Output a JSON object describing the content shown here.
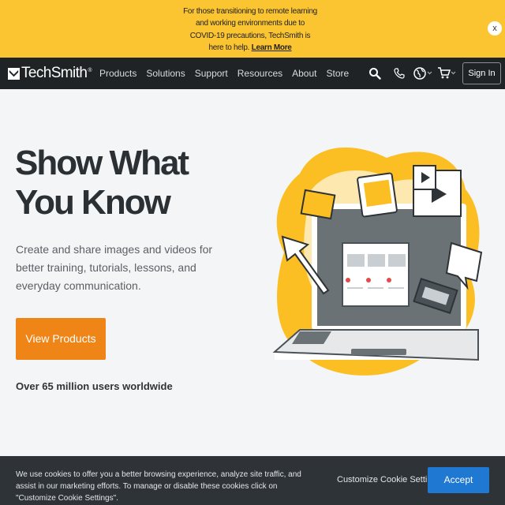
{
  "banner": {
    "text": "For those transitioning to remote learning and working environments due to COVID-19 precautions, TechSmith is here to help.",
    "link_label": "Learn More",
    "close_label": "x"
  },
  "nav": {
    "brand": "TechSmith",
    "registered": "®",
    "links": [
      "Products",
      "Solutions",
      "Support",
      "Resources",
      "About",
      "Store"
    ],
    "icons": [
      "search-icon",
      "phone-icon",
      "globe-icon",
      "cart-icon"
    ],
    "signin_label": "Sign In"
  },
  "hero": {
    "title_line1": "Show What",
    "title_line2": "You Know",
    "subtitle": "Create and share images and videos for better training, tutorials, lessons, and everyday communication.",
    "cta_label": "View Products",
    "users_text": "Over 65 million users worldwide"
  },
  "cookie": {
    "text": "We use cookies to offer you a better browsing experience, analyze site traffic, and assist in our marketing efforts. To manage or disable these cookies click on \"Customize Cookie Settings\".",
    "settings_label": "Customize Cookie Settings",
    "accept_label": "Accept"
  },
  "colors": {
    "banner": "#fbc531",
    "nav": "#1f2326",
    "cta": "#ef8417",
    "accept": "#1f78d1",
    "illustration_yellow": "#fbbf24"
  }
}
